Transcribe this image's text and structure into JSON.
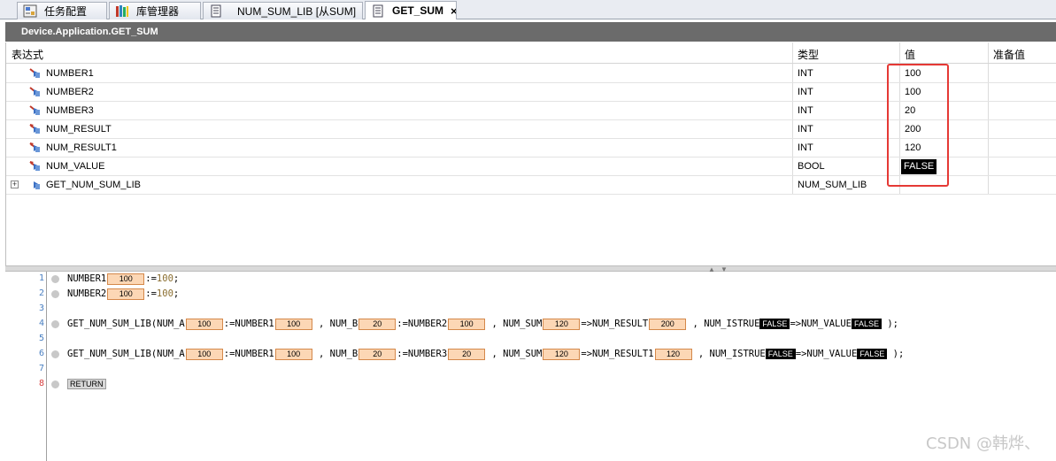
{
  "tabs": [
    {
      "label": "任务配置",
      "icon": "task-config-icon"
    },
    {
      "label": "库管理器",
      "icon": "library-manager-icon"
    },
    {
      "label": "NUM_SUM_LIB [从SUM]",
      "icon": "document-icon"
    },
    {
      "label": "GET_SUM",
      "icon": "document-icon",
      "close": "×"
    }
  ],
  "title": "Device.Application.GET_SUM",
  "watch": {
    "headers": {
      "expr": "表达式",
      "type": "类型",
      "value": "值",
      "prepared": "准备值"
    },
    "rows": [
      {
        "expr": "NUMBER1",
        "type": "INT",
        "value": "100"
      },
      {
        "expr": "NUMBER2",
        "type": "INT",
        "value": "100"
      },
      {
        "expr": "NUMBER3",
        "type": "INT",
        "value": "20"
      },
      {
        "expr": "NUM_RESULT",
        "type": "INT",
        "value": "200"
      },
      {
        "expr": "NUM_RESULT1",
        "type": "INT",
        "value": "120"
      },
      {
        "expr": "NUM_VALUE",
        "type": "BOOL",
        "value": "FALSE"
      },
      {
        "expr": "GET_NUM_SUM_LIB",
        "type": "NUM_SUM_LIB",
        "value": "",
        "expand": "+"
      }
    ]
  },
  "code": {
    "line_numbers": [
      "1",
      "2",
      "3",
      "4",
      "5",
      "6",
      "7",
      "8"
    ],
    "l1": {
      "var": "NUMBER1",
      "val": "100",
      "assign": ":=",
      "lit": "100",
      "end": ";"
    },
    "l2": {
      "var": "NUMBER2",
      "val": "100",
      "assign": ":=",
      "lit": "100",
      "end": ";"
    },
    "l4": {
      "fb": "GET_NUM_SUM_LIB(NUM_A",
      "a_val": "100",
      "a_src": ":=NUMBER1",
      "a_src_val": "100",
      "b": " , NUM_B",
      "b_val": "20",
      "b_src": ":=NUMBER2",
      "b_src_val": "100",
      "sum": " , NUM_SUM",
      "sum_val": "120",
      "sum_dst": "=>NUM_RESULT",
      "sum_dst_val": "200",
      "ist": " , NUM_ISTRUE",
      "ist_val": "FALSE",
      "ist_dst": "=>NUM_VALUE",
      "ist_dst_val": "FALSE",
      "end": " );"
    },
    "l6": {
      "fb": "GET_NUM_SUM_LIB(NUM_A",
      "a_val": "100",
      "a_src": ":=NUMBER1",
      "a_src_val": "100",
      "b": " , NUM_B",
      "b_val": "20",
      "b_src": ":=NUMBER3",
      "b_src_val": "20",
      "sum": " , NUM_SUM",
      "sum_val": "120",
      "sum_dst": "=>NUM_RESULT1",
      "sum_dst_val": "120",
      "ist": " , NUM_ISTRUE",
      "ist_val": "FALSE",
      "ist_dst": "=>NUM_VALUE",
      "ist_dst_val": "FALSE",
      "end": " );"
    },
    "l8": {
      "ret": "RETURN"
    }
  },
  "watermark": "CSDN @韩烨、",
  "colors": {
    "highlight_box": "#e53935",
    "inline_value_bg": "#fcd7b5",
    "titlebar_bg": "#6b6b6b"
  }
}
